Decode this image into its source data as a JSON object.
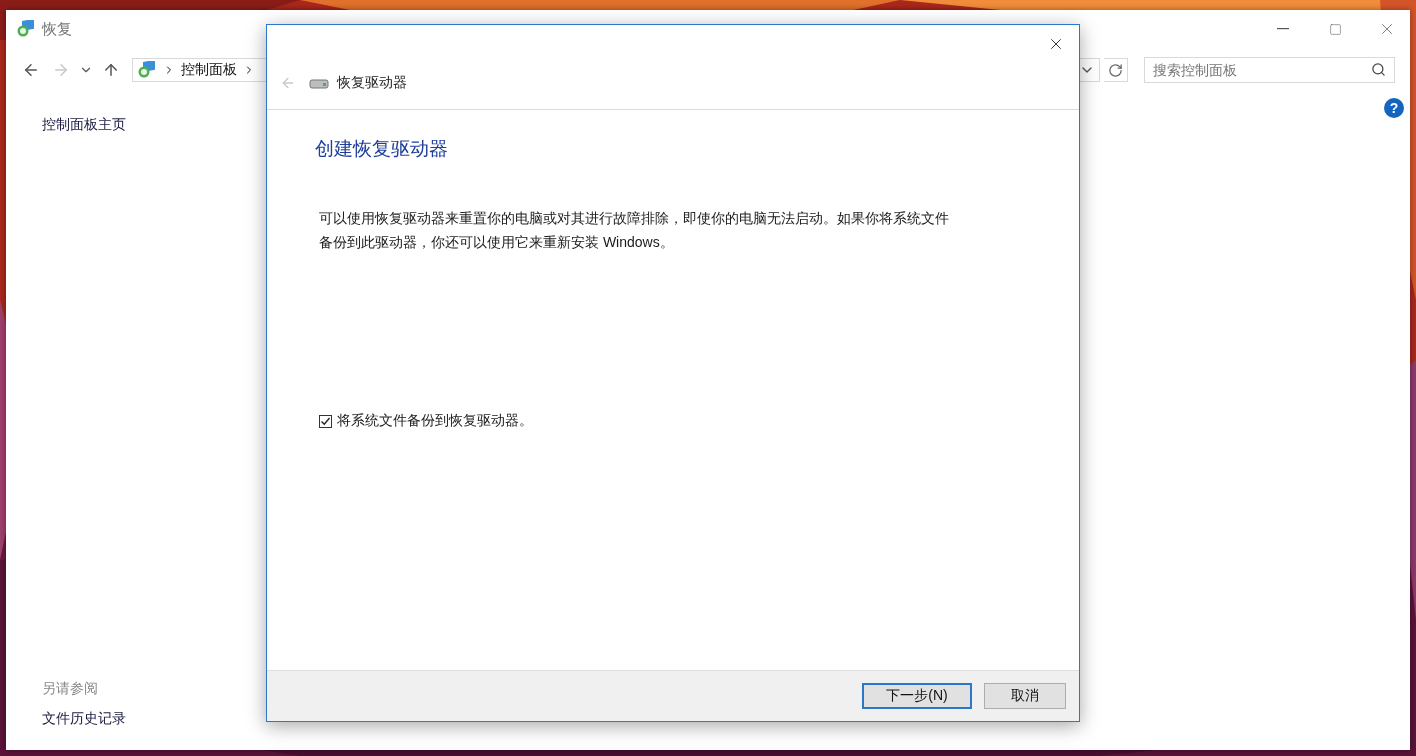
{
  "window": {
    "title": "恢复"
  },
  "nav": {
    "back": {
      "disabled": false
    },
    "forward": {
      "disabled": true
    },
    "address": [
      "控制面板"
    ],
    "search": {
      "placeholder": "搜索控制面板"
    }
  },
  "help": {
    "label": "?"
  },
  "sidebar": {
    "home_link": "控制面板主页",
    "see_also_heading": "另请参阅",
    "see_also_links": [
      "文件历史记录"
    ]
  },
  "dialog": {
    "back": {
      "disabled": true
    },
    "title": "恢复驱动器",
    "heading": "创建恢复驱动器",
    "description": "可以使用恢复驱动器来重置你的电脑或对其进行故障排除，即使你的电脑无法启动。如果你将系统文件备份到此驱动器，你还可以使用它来重新安装 Windows。",
    "checkbox": {
      "label": "将系统文件备份到恢复驱动器。",
      "checked": true
    },
    "buttons": [
      {
        "label": "下一步(N)",
        "default": true
      },
      {
        "label": "取消",
        "default": false
      }
    ]
  }
}
